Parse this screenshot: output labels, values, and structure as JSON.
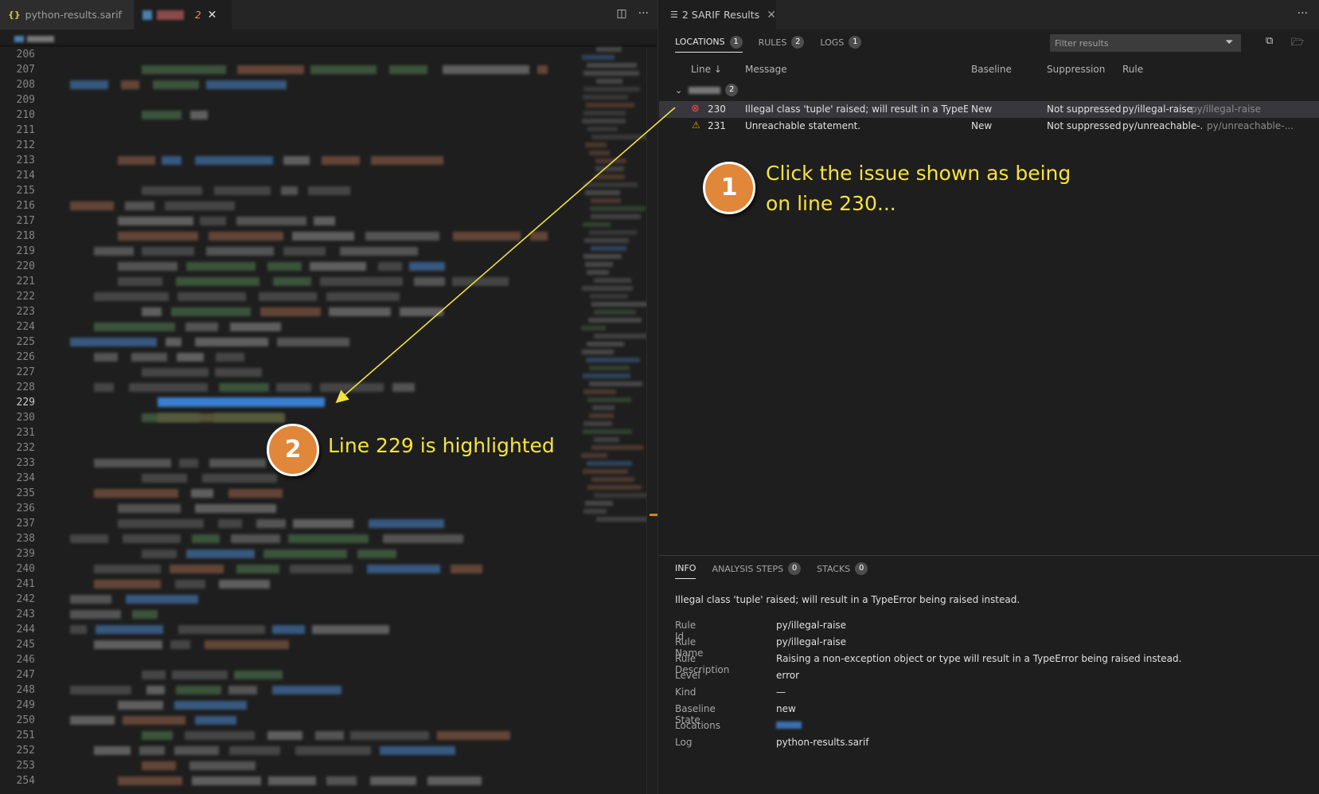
{
  "editor": {
    "tabs": [
      {
        "label": "python-results.sarif",
        "icon": "json-braces-icon"
      },
      {
        "label": "",
        "problem_count": "2",
        "icon": "python-file-icon"
      }
    ],
    "line_numbers": [
      "206",
      "207",
      "208",
      "209",
      "210",
      "211",
      "212",
      "213",
      "214",
      "215",
      "216",
      "217",
      "218",
      "219",
      "220",
      "221",
      "222",
      "223",
      "224",
      "225",
      "226",
      "227",
      "228",
      "229",
      "230",
      "231",
      "232",
      "233",
      "234",
      "235",
      "236",
      "237",
      "238",
      "239",
      "240",
      "241",
      "242",
      "243",
      "244",
      "245",
      "246",
      "247",
      "248",
      "249",
      "250",
      "251",
      "252",
      "253",
      "254"
    ],
    "current_line": "229"
  },
  "sarif": {
    "panel_title": "2 SARIF Results",
    "subtabs": [
      {
        "label": "LOCATIONS",
        "count": "1"
      },
      {
        "label": "RULES",
        "count": "2"
      },
      {
        "label": "LOGS",
        "count": "1"
      }
    ],
    "filter_placeholder": "Filter results",
    "columns": {
      "line": "Line",
      "message": "Message",
      "baseline": "Baseline",
      "suppression": "Suppression",
      "rule": "Rule"
    },
    "group_count": "2",
    "results": [
      {
        "severity": "error",
        "line": "230",
        "message": "Illegal class 'tuple' raised; will result in a TypeErro...",
        "baseline": "New",
        "suppression": "Not suppressed",
        "rule": "py/illegal-raise",
        "rule_id": "py/illegal-raise"
      },
      {
        "severity": "warning",
        "line": "231",
        "message": "Unreachable statement.",
        "baseline": "New",
        "suppression": "Not suppressed",
        "rule": "py/unreachable-...",
        "rule_id": "py/unreachable-..."
      }
    ],
    "info_tabs": [
      {
        "label": "INFO"
      },
      {
        "label": "ANALYSIS STEPS",
        "count": "0"
      },
      {
        "label": "STACKS",
        "count": "0"
      }
    ],
    "info": {
      "message": "Illegal class 'tuple' raised; will result in a TypeError being raised instead.",
      "rule_id_label": "Rule Id",
      "rule_id": "py/illegal-raise",
      "rule_name_label": "Rule Name",
      "rule_name": "py/illegal-raise",
      "rule_desc_label": "Rule Description",
      "rule_desc": "Raising a non-exception object or type will result in a TypeError being raised instead.",
      "level_label": "Level",
      "level": "error",
      "kind_label": "Kind",
      "kind": "—",
      "baseline_label": "Baseline State",
      "baseline": "new",
      "locations_label": "Locations",
      "log_label": "Log",
      "log": "python-results.sarif"
    }
  },
  "annotations": {
    "step1_number": "1",
    "step1_line1": "Click the issue shown as being",
    "step1_line2": "on line 230...",
    "step2_number": "2",
    "step2_text": "Line 229 is highlighted",
    "accent": "#e0873a",
    "text_color": "#f7e43a"
  }
}
